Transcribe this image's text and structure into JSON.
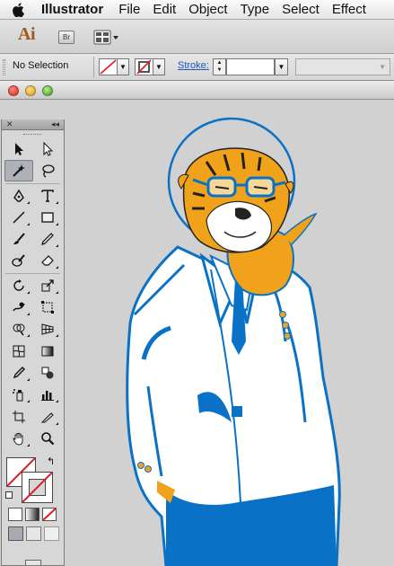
{
  "menubar": {
    "apple_icon": "apple-logo",
    "app_name": "Illustrator",
    "items": [
      "File",
      "Edit",
      "Object",
      "Type",
      "Select",
      "Effect"
    ]
  },
  "appbar": {
    "logo": "Ai",
    "bridge_label": "Br",
    "arrange_icon": "arrange-documents-icon"
  },
  "control_panel": {
    "selection_status": "No Selection",
    "fill_icon": "fill-none-swatch",
    "stroke_swatch_icon": "stroke-none-swatch",
    "stroke_label": "Stroke:",
    "stroke_value": "",
    "style_value": ""
  },
  "document_window": {
    "buttons": [
      "close",
      "minimize",
      "zoom"
    ]
  },
  "tools": [
    [
      "selection-tool",
      "direct-selection-tool"
    ],
    [
      "magic-wand-tool",
      "lasso-tool"
    ],
    [
      "pen-tool",
      "type-tool"
    ],
    [
      "line-segment-tool",
      "rectangle-tool"
    ],
    [
      "paintbrush-tool",
      "pencil-tool"
    ],
    [
      "blob-brush-tool",
      "eraser-tool"
    ],
    [
      "rotate-tool",
      "scale-tool"
    ],
    [
      "warp-tool",
      "free-transform-tool"
    ],
    [
      "shape-builder-tool",
      "perspective-grid-tool"
    ],
    [
      "mesh-tool",
      "gradient-tool"
    ],
    [
      "eyedropper-tool",
      "blend-tool"
    ],
    [
      "symbol-sprayer-tool",
      "column-graph-tool"
    ],
    [
      "artboard-tool",
      "slice-tool"
    ],
    [
      "hand-tool",
      "zoom-tool"
    ]
  ],
  "colors": {
    "artwork_blue": "#0a72c6",
    "artwork_orange": "#f1a21b",
    "canvas": "#d1d1d1",
    "panel": "#d7d7d7"
  }
}
